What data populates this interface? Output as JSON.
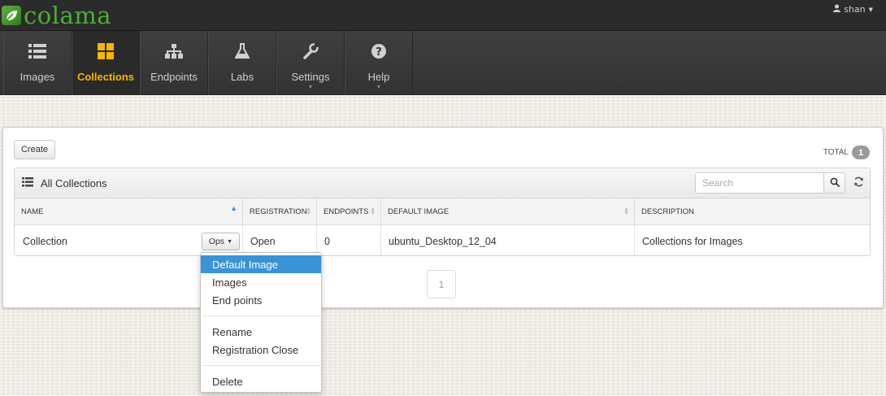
{
  "app": {
    "brand": "colama"
  },
  "user": {
    "name": "shan"
  },
  "nav": {
    "items": [
      {
        "label": "Images",
        "icon": "list-icon",
        "active": false
      },
      {
        "label": "Collections",
        "icon": "grid-icon",
        "active": true
      },
      {
        "label": "Endpoints",
        "icon": "sitemap-icon",
        "active": false
      },
      {
        "label": "Labs",
        "icon": "flask-icon",
        "active": false
      },
      {
        "label": "Settings",
        "icon": "wrench-icon",
        "active": false,
        "has_dropdown": true
      },
      {
        "label": "Help",
        "icon": "question-circle-icon",
        "active": false,
        "has_dropdown": true
      }
    ]
  },
  "toolbar": {
    "create_label": "Create",
    "total_label": "TOTAL",
    "total_count": "1"
  },
  "table": {
    "title": "All Collections",
    "search_placeholder": "Search",
    "columns": [
      "NAME",
      "REGISTRATION",
      "ENDPOINTS",
      "DEFAULT IMAGE",
      "DESCRIPTION"
    ],
    "rows": [
      {
        "name": "Collection",
        "registration": "Open",
        "endpoints": "0",
        "default_image": "ubuntu_Desktop_12_04",
        "description": "Collections for Images"
      }
    ],
    "ops_label": "Ops"
  },
  "pagination": {
    "current_page": "1"
  },
  "ops_menu": {
    "items": [
      "Default Image",
      "Images",
      "End points",
      "Rename",
      "Registration Close",
      "Delete"
    ],
    "highlighted": "Default Image"
  },
  "colors": {
    "brand_green": "#4caf36",
    "nav_active": "#f7b500",
    "menu_highlight": "#3a93d6"
  }
}
